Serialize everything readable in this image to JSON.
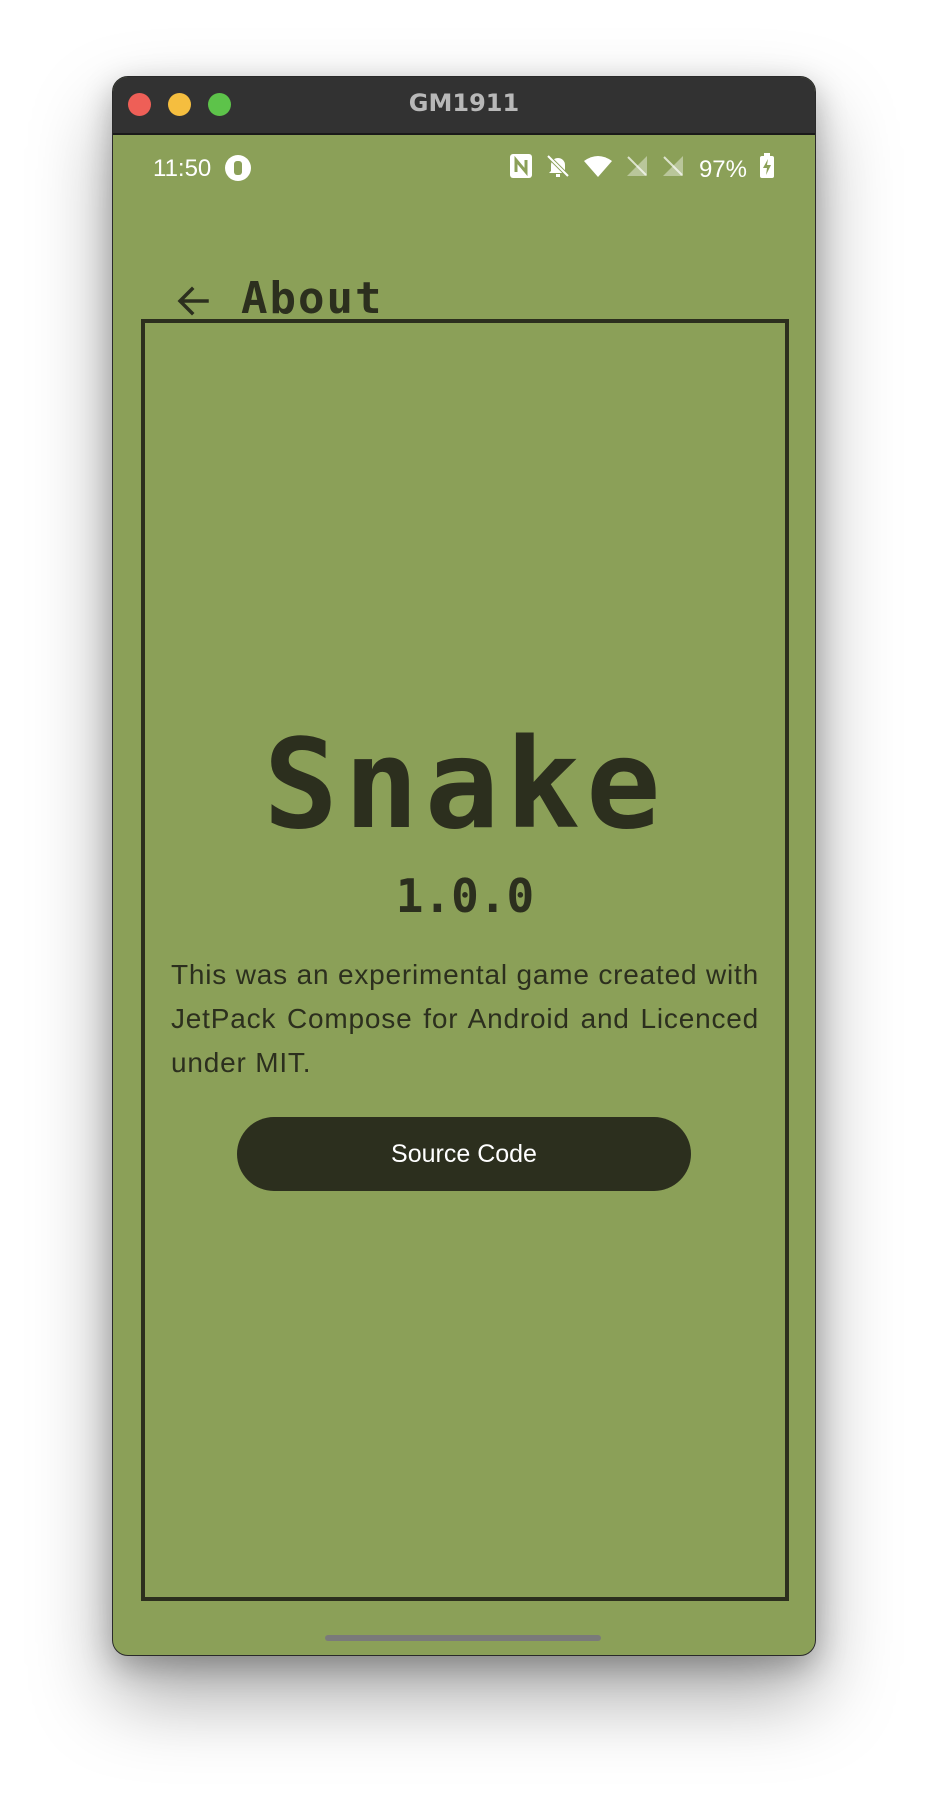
{
  "window": {
    "title": "GM1911"
  },
  "status_bar": {
    "time": "11:50",
    "battery": "97%",
    "icons": [
      "app-icon",
      "nfc-icon",
      "mute-icon",
      "wifi-icon",
      "no-signal-icon",
      "no-signal-icon",
      "battery-charging-icon"
    ]
  },
  "app_bar": {
    "title": "About",
    "back_icon": "arrow-back-icon"
  },
  "content": {
    "game_title": "Snake",
    "version": "1.0.0",
    "description": "This was an experimental game created with JetPack Compose for Android and Licenced under MIT.",
    "source_button_label": "Source Code"
  },
  "colors": {
    "background": "#8ba058",
    "foreground": "#2c2f1e",
    "button_text": "#ffffff",
    "titlebar": "#323232"
  }
}
